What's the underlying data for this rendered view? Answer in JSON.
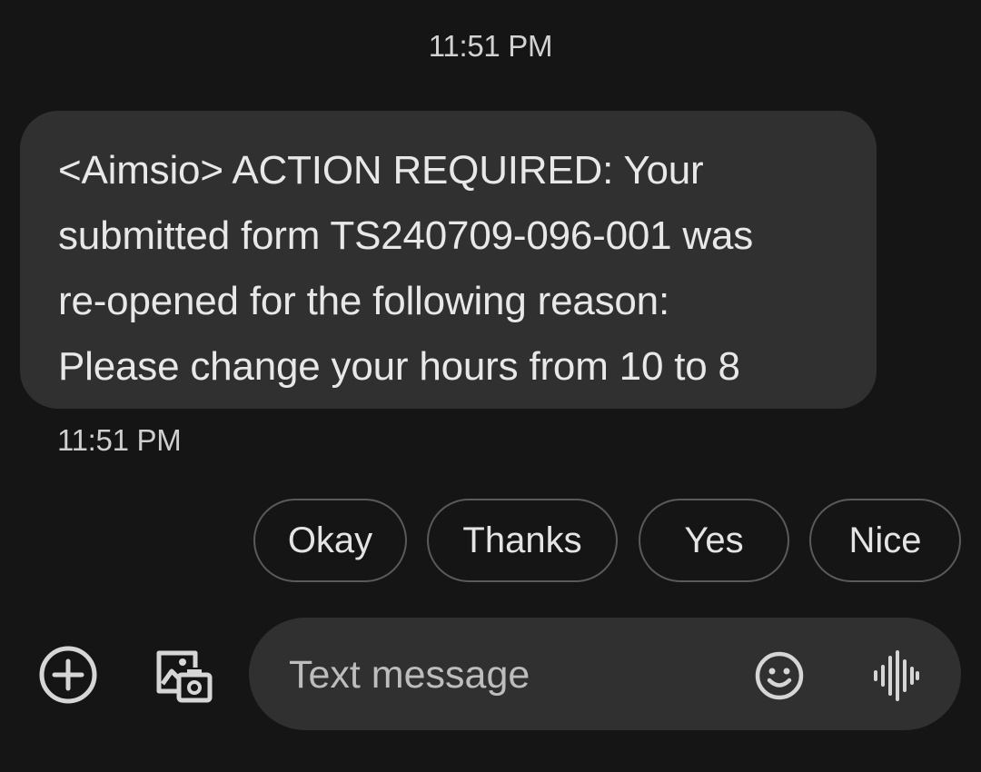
{
  "thread": {
    "header_timestamp": "11:51 PM",
    "message": {
      "text": "<Aimsio> ACTION REQUIRED: Your\nsubmitted form TS240709-096-001 was\nre-opened for the following reason:\nPlease change your hours from 10 to 8",
      "timestamp": "11:51 PM"
    }
  },
  "smart_replies": [
    "Okay",
    "Thanks",
    "Yes",
    "Nice"
  ],
  "composer": {
    "placeholder": "Text message",
    "value": "",
    "icons": {
      "add": "add-circle-icon",
      "gallery": "gallery-camera-icon",
      "emoji": "emoji-icon",
      "voice": "voice-waveform-icon"
    }
  },
  "colors": {
    "background": "#151515",
    "bubble": "#303030",
    "chip_border": "#5a5a5a",
    "text": "#e6e6e6"
  }
}
